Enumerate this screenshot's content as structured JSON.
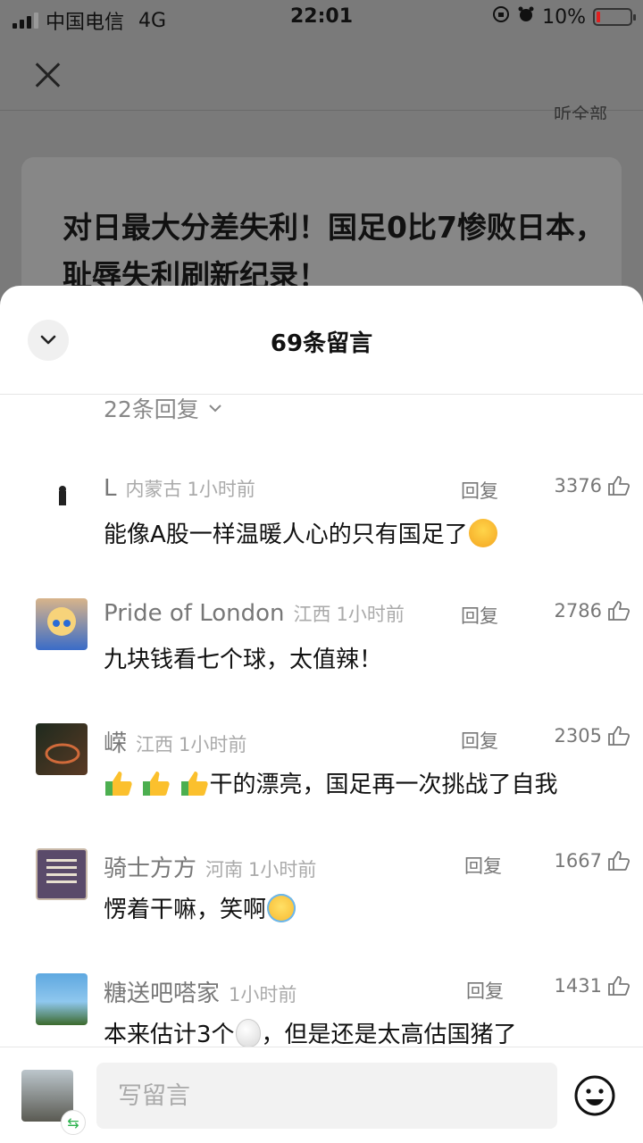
{
  "status_bar": {
    "carrier": "中国电信",
    "network": "4G",
    "time": "22:01",
    "battery": "10%",
    "battery_color": "#e02020"
  },
  "background_page": {
    "close_icon": "close-icon",
    "listen_all": "听全部",
    "article_title": "对日最大分差失利！国足0比7惨败日本，耻辱失利刷新纪录！"
  },
  "sheet": {
    "title": "69条留言",
    "collapse_icon": "chevron-down-icon",
    "replies_link": "22条回复"
  },
  "comments": [
    {
      "name": "L",
      "region": "内蒙古",
      "time": "1小时前",
      "reply": "回复",
      "likes": "3376",
      "text": "能像A股一样温暖人心的只有国足了",
      "emoji_after": "angry-face"
    },
    {
      "name": "Pride of London",
      "region": "江西",
      "time": "1小时前",
      "reply": "回复",
      "likes": "2786",
      "text": "九块钱看七个球，太值辣！"
    },
    {
      "name": "嵘",
      "region": "江西",
      "time": "1小时前",
      "reply": "回复",
      "likes": "2305",
      "text": "干的漂亮，国足再一次挑战了自我",
      "emoji_before": [
        "thumbs-up",
        "thumbs-up",
        "thumbs-up"
      ]
    },
    {
      "name": "骑士方方",
      "region": "河南",
      "time": "1小时前",
      "reply": "回复",
      "likes": "1667",
      "text": "愣着干嘛，笑啊",
      "emoji_after": "laughing-tears"
    },
    {
      "name": "糖送吧嗒家",
      "region": "",
      "time": "1小时前",
      "reply": "回复",
      "likes": "1431",
      "text_a": "本来估计3个",
      "emoji_mid": "egg",
      "text_b": "，但是还是太高估国猪了"
    }
  ],
  "footer": {
    "input_placeholder": "写留言",
    "emoji_icon": "smiley-face-icon",
    "switch_icon": "switch-account-icon",
    "accent": "#2bb24c"
  }
}
